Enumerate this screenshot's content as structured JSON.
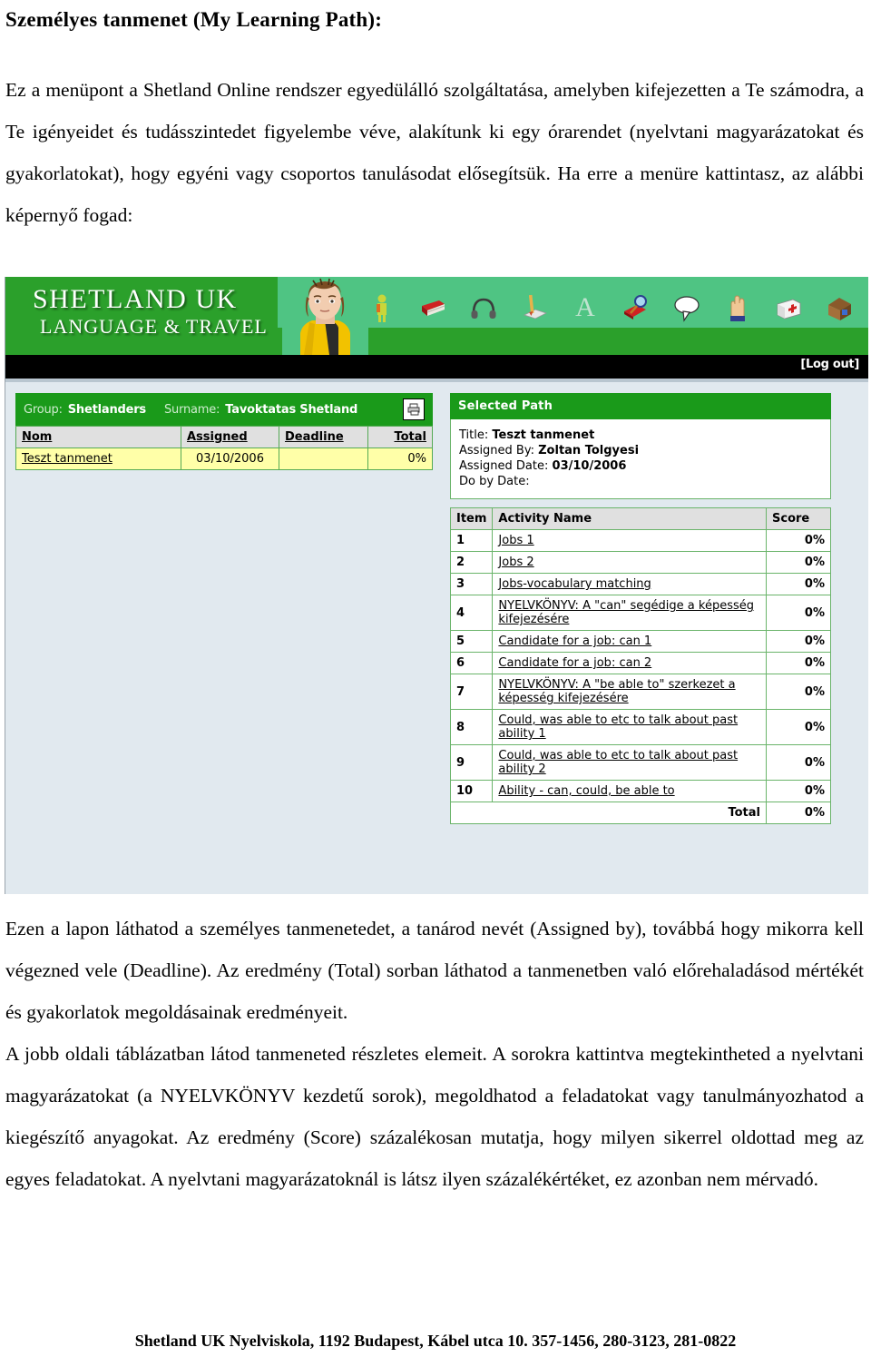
{
  "document": {
    "title": "Személyes tanmenet (My Learning Path):",
    "intro_paragraph": "Ez a menüpont a Shetland Online rendszer egyedülálló szolgáltatása, amelyben kifejezetten a Te számodra, a Te igényeidet és tudásszintedet figyelembe véve, alakítunk ki egy órarendet (nyelvtani magyarázatokat és gyakorlatokat), hogy egyéni vagy csoportos tanulásodat elősegítsük. Ha erre a menüre kattintasz, az alábbi képernyő fogad:",
    "after_paragraph_1": "Ezen a lapon láthatod a személyes tanmenetedet, a tanárod nevét (Assigned by), továbbá hogy mikorra kell végezned vele (Deadline). Az eredmény (Total) sorban láthatod a tanmenetben való előrehaladásod mértékét és gyakorlatok megoldásainak eredményeit.",
    "after_paragraph_2": "A jobb oldali táblázatban látod tanmeneted részletes elemeit. A sorokra kattintva megtekintheted a nyelvtani magyarázatokat (a NYELVKÖNYV kezdetű sorok), megoldhatod a feladatokat vagy tanulmányozhatod a kiegészítő anyagokat. Az eredmény (Score) százalékosan mutatja, hogy milyen sikerrel oldottad meg az egyes feladatokat. A nyelvtani magyarázatoknál is látsz ilyen százalékértéket, ez azonban nem mérvadó.",
    "footer": "Shetland UK Nyelviskola, 1192 Budapest, Kábel utca 10. 357-1456, 280-3123, 281-0822"
  },
  "screenshot": {
    "banner": {
      "logo_line1": "SHETLAND UK",
      "logo_line2": "LANGUAGE & TRAVEL",
      "letter_icon": "A",
      "icons": [
        "person-icon",
        "red-book-icon",
        "headphones-icon",
        "pencil-paper-icon",
        "letter-a-icon",
        "book-magnifier-icon",
        "speech-bubble-icon",
        "raised-hand-icon",
        "first-aid-kit-icon",
        "house-icon"
      ]
    },
    "logout_label": "[Log out]",
    "left_panel": {
      "group_label": "Group:",
      "group_value": "Shetlanders",
      "surname_label": "Surname:",
      "surname_value": "Tavoktatas Shetland",
      "print_icon": "printer-icon",
      "columns": [
        "Nom",
        "Assigned",
        "Deadline",
        "Total"
      ],
      "rows": [
        {
          "nom": "Teszt tanmenet",
          "assigned": "03/10/2006",
          "deadline": "",
          "total": "0%"
        }
      ]
    },
    "right_panel": {
      "header": "Selected Path",
      "details": [
        {
          "label": "Title:",
          "value": "Teszt tanmenet"
        },
        {
          "label": "Assigned By:",
          "value": "Zoltan Tolgyesi"
        },
        {
          "label": "Assigned Date:",
          "value": "03/10/2006"
        },
        {
          "label": "Do by Date:",
          "value": ""
        }
      ],
      "activity_columns": [
        "Item",
        "Activity Name",
        "Score"
      ],
      "activities": [
        {
          "item": "1",
          "name": "Jobs 1",
          "score": "0%"
        },
        {
          "item": "2",
          "name": "Jobs 2",
          "score": "0%"
        },
        {
          "item": "3",
          "name": "Jobs-vocabulary matching",
          "score": "0%"
        },
        {
          "item": "4",
          "name": "NYELVKÖNYV: A \"can\" segédige a képesség kifejezésére",
          "score": "0%"
        },
        {
          "item": "5",
          "name": "Candidate for a job: can 1",
          "score": "0%"
        },
        {
          "item": "6",
          "name": "Candidate for a job: can 2",
          "score": "0%"
        },
        {
          "item": "7",
          "name": "NYELVKÖNYV: A \"be able to\" szerkezet a képesség kifejezésére",
          "score": "0%"
        },
        {
          "item": "8",
          "name": "Could, was able to etc to talk about past ability 1",
          "score": "0%"
        },
        {
          "item": "9",
          "name": "Could, was able to etc to talk about past ability 2",
          "score": "0%"
        },
        {
          "item": "10",
          "name": "Ability - can, could, be able to",
          "score": "0%"
        }
      ],
      "total_label": "Total",
      "total_value": "0%"
    },
    "colors": {
      "brand_green": "#1a9a1a",
      "banner_light_green": "#4fc483",
      "page_background": "#e1e9ef",
      "row_highlight": "#ffffa8",
      "header_grey": "#e0e0e0"
    }
  }
}
